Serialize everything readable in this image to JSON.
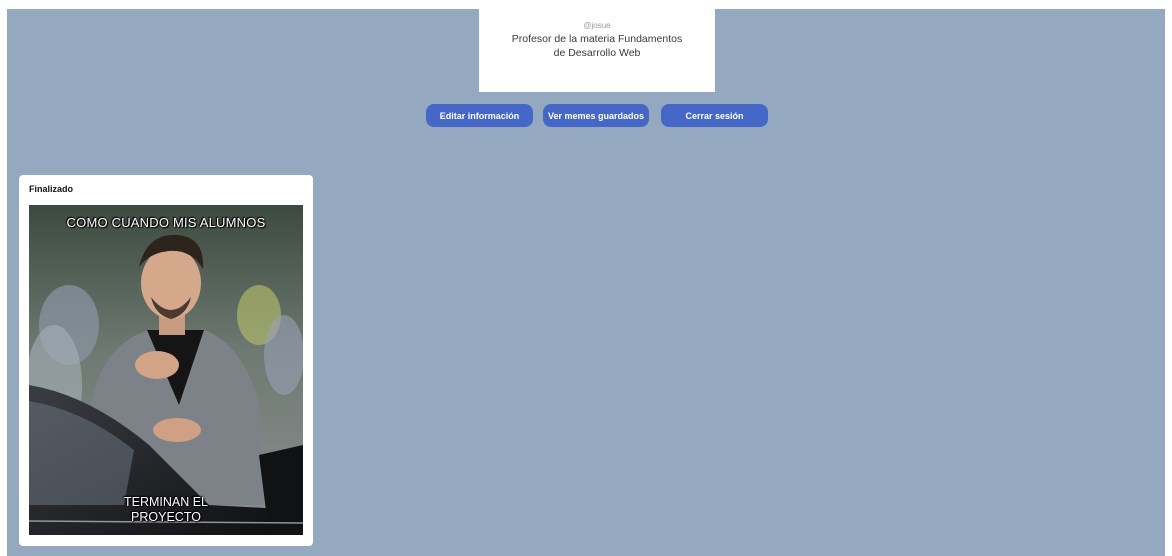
{
  "profile": {
    "username": "@josue",
    "bio": "Profesor de la materia Fundamentos de Desarrollo Web"
  },
  "actions": {
    "edit_label": "Editar información",
    "saved_label": "Ver memes guardados",
    "logout_label": "Cerrar sesión"
  },
  "meme": {
    "status": "Finalizado",
    "top_text": "COMO CUANDO MIS ALUMNOS",
    "bottom_line1": "TERMINAN EL",
    "bottom_line2": "PROYECTO"
  },
  "colors": {
    "page_background": "#94a8bf",
    "button": "#4567c8",
    "card": "#ffffff"
  }
}
